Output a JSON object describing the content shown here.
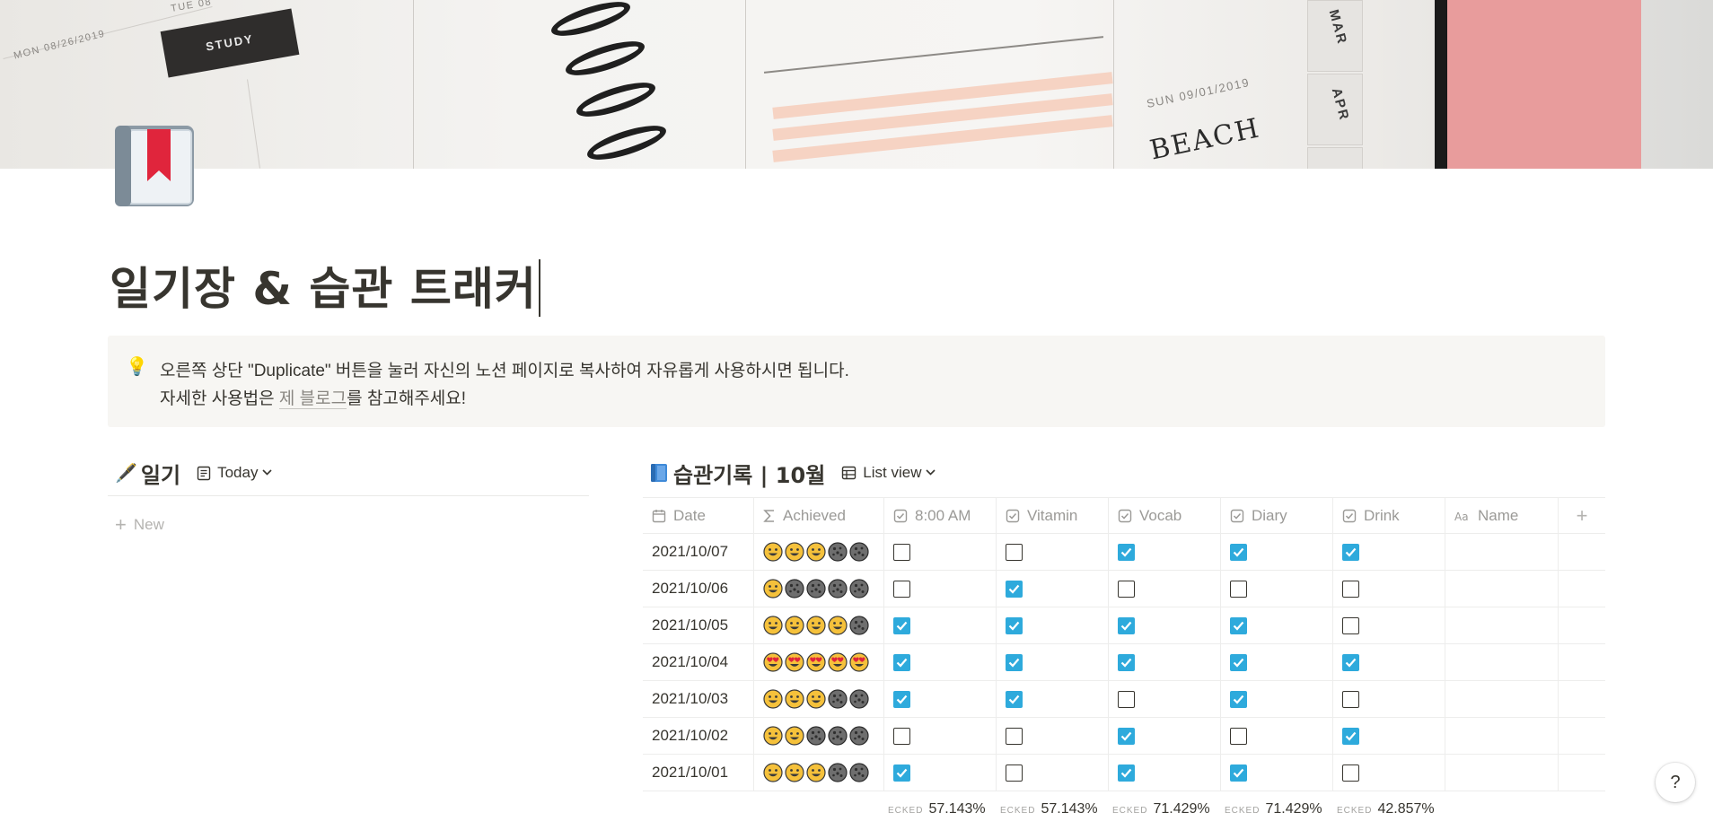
{
  "page": {
    "title": "일기장 & 습관 트래커"
  },
  "callout": {
    "icon": "lightbulb-icon",
    "line1": "오른쪽 상단 \"Duplicate\" 버튼을 눌러 자신의 노션 페이지로 복사하여 자유롭게 사용하시면 됩니다.",
    "line2_prefix": "자세한 사용법은 ",
    "line2_link": "제 블로그",
    "line2_suffix": "를 참고해주세요!"
  },
  "diary": {
    "icon": "pen-icon",
    "heading": "일기",
    "view_label": "Today",
    "new_label": "New"
  },
  "habits": {
    "icon": "blue-book-icon",
    "heading": "습관기록 | 10월",
    "view_label": "List view",
    "columns": [
      "Date",
      "Achieved",
      "8:00 AM",
      "Vitamin",
      "Vocab",
      "Diary",
      "Drink",
      "Name"
    ],
    "rows": [
      {
        "date": "2021/10/07",
        "achieved": [
          "smile",
          "smile",
          "smile",
          "cookie",
          "cookie"
        ],
        "checks": [
          false,
          false,
          true,
          true,
          true
        ]
      },
      {
        "date": "2021/10/06",
        "achieved": [
          "smile",
          "cookie",
          "cookie",
          "cookie",
          "cookie"
        ],
        "checks": [
          false,
          true,
          false,
          false,
          false
        ]
      },
      {
        "date": "2021/10/05",
        "achieved": [
          "smile",
          "smile",
          "smile",
          "smile",
          "cookie"
        ],
        "checks": [
          true,
          true,
          true,
          true,
          false
        ]
      },
      {
        "date": "2021/10/04",
        "achieved": [
          "heart",
          "heart",
          "heart",
          "heart",
          "heart"
        ],
        "checks": [
          true,
          true,
          true,
          true,
          true
        ]
      },
      {
        "date": "2021/10/03",
        "achieved": [
          "smile",
          "smile",
          "smile",
          "cookie",
          "cookie"
        ],
        "checks": [
          true,
          true,
          false,
          true,
          false
        ]
      },
      {
        "date": "2021/10/02",
        "achieved": [
          "smile",
          "smile",
          "cookie",
          "cookie",
          "cookie"
        ],
        "checks": [
          false,
          false,
          true,
          false,
          true
        ]
      },
      {
        "date": "2021/10/01",
        "achieved": [
          "smile",
          "smile",
          "smile",
          "cookie",
          "cookie"
        ],
        "checks": [
          true,
          false,
          true,
          true,
          false
        ]
      }
    ],
    "calc_label": "ECKED",
    "calc_values": [
      "57.143%",
      "57.143%",
      "71.429%",
      "71.429%",
      "42.857%"
    ]
  },
  "help_label": "?",
  "colors": {
    "checkbox_on": "#2eaadc",
    "text": "#37352f",
    "muted": "#9b9a97"
  }
}
